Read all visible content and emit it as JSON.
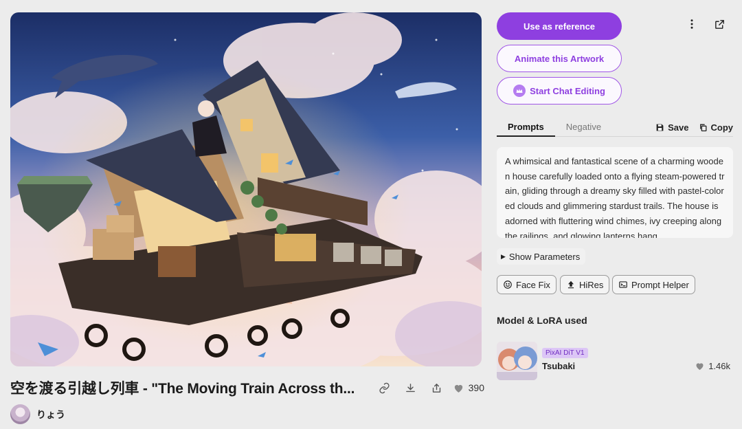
{
  "artwork": {
    "title": "空を渡る引越し列車 - \"The Moving Train Across th...",
    "like_count": "390",
    "author": "りょう"
  },
  "actions": {
    "use_reference": "Use as reference",
    "animate": "Animate this Artwork",
    "chat_editing": "Start Chat Editing"
  },
  "tabs": {
    "prompts": "Prompts",
    "negative": "Negative",
    "save": "Save",
    "copy": "Copy"
  },
  "prompt_text": "A whimsical and fantastical scene of a charming wooden house carefully loaded onto a flying steam-powered train, gliding through a dreamy sky filled with pastel-colored clouds and glimmering stardust trails. The house is adorned with fluttering wind chimes, ivy creeping along the railings, and glowing lanterns hang",
  "show_parameters": "Show Parameters",
  "tools": {
    "face_fix": "Face Fix",
    "hires": "HiRes",
    "prompt_helper": "Prompt Helper"
  },
  "models": {
    "section_title": "Model & LoRA used",
    "items": [
      {
        "badge": "PixAI DiT V1",
        "name": "Tsubaki",
        "likes": "1.46k"
      }
    ]
  },
  "colors": {
    "accent": "#8e3fe0",
    "background": "#ececec"
  }
}
